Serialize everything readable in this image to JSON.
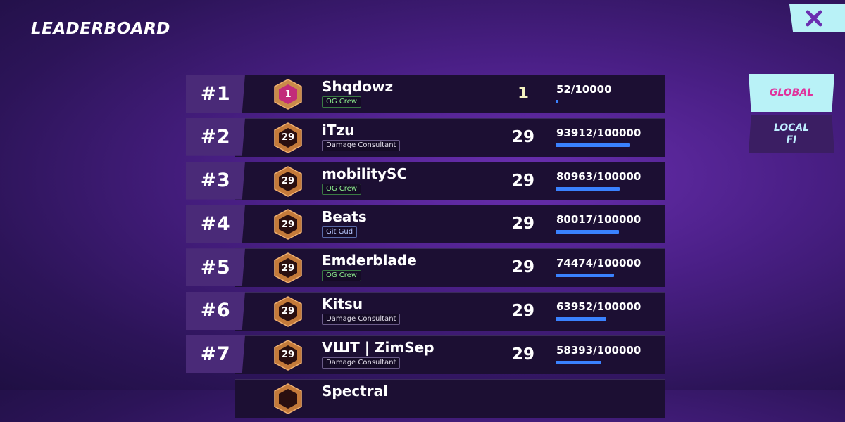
{
  "title": "LEADERBOARD",
  "close_icon": "close-x-icon",
  "tabs": [
    {
      "label": "GLOBAL",
      "selected": true
    },
    {
      "label": "LOCAL\nFI",
      "selected": false
    }
  ],
  "colors": {
    "accent_cyan": "#b9f2f7",
    "accent_pink": "#e0329c",
    "xp_bar": "#3a82ff",
    "badge_bronze": "#c47a3a",
    "badge_first": "#c22b7a"
  },
  "rows": [
    {
      "rank": "#1",
      "badge": "1",
      "name": "Shqdowz",
      "tag": "OG Crew",
      "level": "1",
      "xp": "52/10000",
      "progress": 0.0052
    },
    {
      "rank": "#2",
      "badge": "29",
      "name": "iTzu",
      "tag": "Damage Consultant",
      "level": "29",
      "xp": "93912/100000",
      "progress": 0.93912
    },
    {
      "rank": "#3",
      "badge": "29",
      "name": "mobilitySC",
      "tag": "OG Crew",
      "level": "29",
      "xp": "80963/100000",
      "progress": 0.80963
    },
    {
      "rank": "#4",
      "badge": "29",
      "name": "Beats",
      "tag": "Git Gud",
      "level": "29",
      "xp": "80017/100000",
      "progress": 0.80017
    },
    {
      "rank": "#5",
      "badge": "29",
      "name": "Emderblade",
      "tag": "OG Crew",
      "level": "29",
      "xp": "74474/100000",
      "progress": 0.74474
    },
    {
      "rank": "#6",
      "badge": "29",
      "name": "Kitsu",
      "tag": "Damage Consultant",
      "level": "29",
      "xp": "63952/100000",
      "progress": 0.63952
    },
    {
      "rank": "#7",
      "badge": "29",
      "name": "VШT | ZimSep",
      "tag": "Damage Consultant",
      "level": "29",
      "xp": "58393/100000",
      "progress": 0.58393
    },
    {
      "rank": "",
      "badge": "",
      "name": "Spectral",
      "tag": "",
      "level": "",
      "xp": "",
      "progress": 0
    }
  ]
}
